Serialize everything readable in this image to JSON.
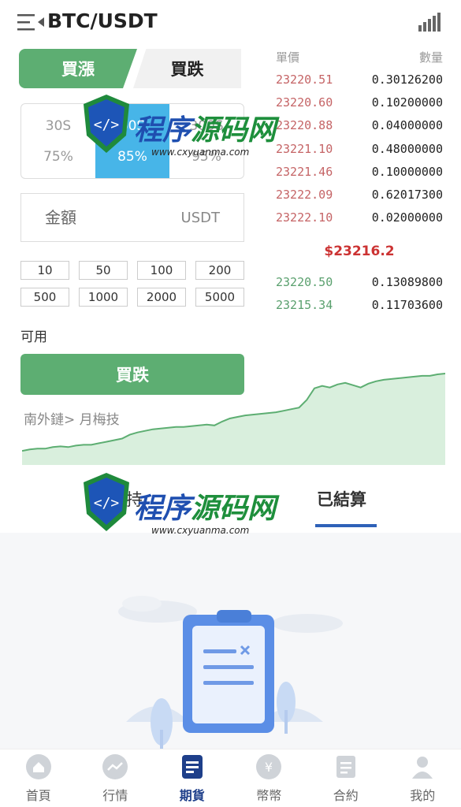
{
  "header": {
    "title": "BTC/USDT",
    "menu_icon": "menu-icon",
    "signal_icon": "signal-bars-icon"
  },
  "trade_tabs": {
    "up_label": "買漲",
    "down_label": "買跌"
  },
  "periods": [
    {
      "time": "30S",
      "odds": "75%",
      "active": false
    },
    {
      "time": "60S",
      "odds": "85%",
      "active": true
    },
    {
      "time": "300S",
      "odds": "95%",
      "active": false
    }
  ],
  "amount": {
    "placeholder": "金額",
    "unit": "USDT"
  },
  "quick_amounts": [
    "10",
    "50",
    "100",
    "200",
    "500",
    "1000",
    "2000",
    "5000"
  ],
  "available_label": "可用",
  "submit_label": "買跌",
  "guide_link": "南外鏈> 月梅技",
  "orderbook": {
    "price_header": "單價",
    "qty_header": "數量",
    "asks": [
      {
        "price": "23220.51",
        "qty": "0.30126200"
      },
      {
        "price": "23220.60",
        "qty": "0.10200000"
      },
      {
        "price": "23220.88",
        "qty": "0.04000000"
      },
      {
        "price": "23221.10",
        "qty": "0.48000000"
      },
      {
        "price": "23221.46",
        "qty": "0.10000000"
      },
      {
        "price": "23222.09",
        "qty": "0.62017300"
      },
      {
        "price": "23222.10",
        "qty": "0.02000000"
      }
    ],
    "mid_price": "$23216.2",
    "bids": [
      {
        "price": "23220.50",
        "qty": "0.13089800"
      },
      {
        "price": "23215.34",
        "qty": "0.11703600"
      }
    ]
  },
  "chart_data": {
    "type": "area",
    "values": [
      14,
      16,
      17,
      17,
      19,
      20,
      19,
      21,
      22,
      22,
      24,
      26,
      28,
      30,
      35,
      38,
      40,
      42,
      43,
      44,
      45,
      45,
      46,
      47,
      48,
      47,
      52,
      56,
      58,
      60,
      61,
      62,
      63,
      64,
      66,
      68,
      70,
      80,
      95,
      98,
      96,
      100,
      102,
      99,
      96,
      101,
      104,
      106,
      107,
      108,
      109,
      110,
      111,
      111,
      113,
      114
    ],
    "color": "#5dae72"
  },
  "records": {
    "tab_pending": "持",
    "tab_settled": "已結算"
  },
  "bottom_nav": [
    {
      "label": "首頁",
      "icon": "home-icon",
      "active": false
    },
    {
      "label": "行情",
      "icon": "chart-icon",
      "active": false
    },
    {
      "label": "期貨",
      "icon": "futures-icon",
      "active": true
    },
    {
      "label": "幣幣",
      "icon": "coin-icon",
      "active": false
    },
    {
      "label": "合約",
      "icon": "contract-icon",
      "active": false
    },
    {
      "label": "我的",
      "icon": "user-icon",
      "active": false
    }
  ],
  "watermark": {
    "text_a": "程序",
    "text_b": "源码网",
    "url": "www.cxyuanma.com"
  },
  "colors": {
    "green": "#5dae72",
    "blue_active": "#47b5e8",
    "ask_red": "#c56466",
    "bid_green": "#5aa06e",
    "nav_active": "#1e3f8a"
  }
}
